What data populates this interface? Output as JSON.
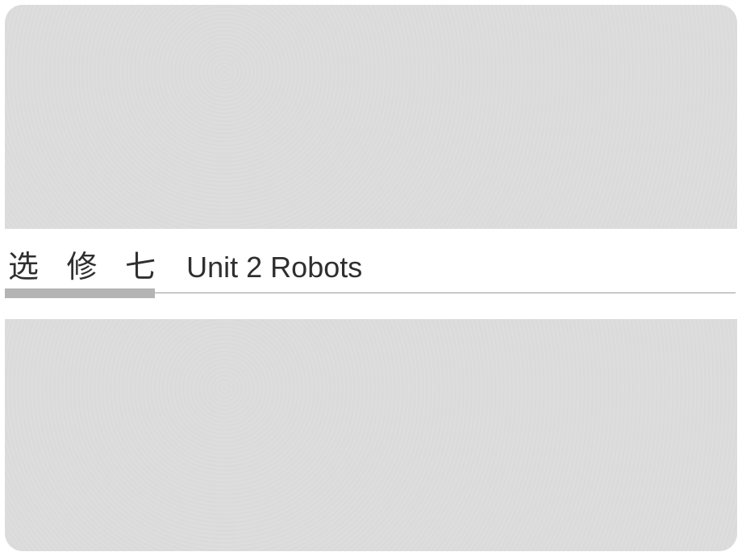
{
  "slide": {
    "prefix": "选 修 七",
    "title": "Unit 2  Robots"
  }
}
